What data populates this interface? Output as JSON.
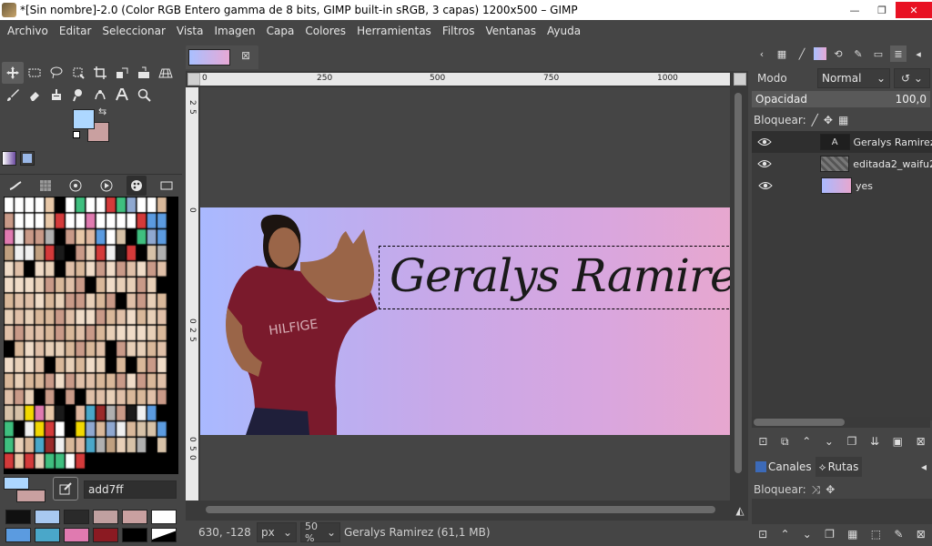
{
  "window": {
    "title": "*[Sin nombre]-2.0 (Color RGB Entero gamma de 8 bits, GIMP built-in sRGB, 3 capas) 1200x500 – GIMP",
    "minimize": "—",
    "maximize": "❐",
    "close": "✕"
  },
  "menu": {
    "items": [
      "Archivo",
      "Editar",
      "Seleccionar",
      "Vista",
      "Imagen",
      "Capa",
      "Colores",
      "Herramientas",
      "Filtros",
      "Ventanas",
      "Ayuda"
    ]
  },
  "toolbox": {
    "tools": [
      "move-tool-icon",
      "rect-select-icon",
      "lasso-icon",
      "fuzzy-select-icon",
      "crop-icon",
      "transform-icon",
      "warp-icon",
      "perspective-icon",
      "paintbrush-icon",
      "eraser-icon",
      "clone-icon",
      "smudge-icon",
      "paths-icon",
      "text-icon",
      "zoom-icon"
    ],
    "foreground_color": "#add7ff",
    "background_color": "#c9a0a0"
  },
  "color_panel": {
    "hex_value": "add7ff",
    "recent_colors": [
      "#101010",
      "#a8c8f0",
      "#2a2a2a",
      "#c0a0a0",
      "#c9a0a0",
      "#ffffff",
      "#5b9be0",
      "#4aa7c9",
      "#e07ab0",
      "#8b1a22",
      "#000000",
      "#ffffff"
    ]
  },
  "image_tab": {
    "close": "⊠"
  },
  "rulers": {
    "h_labels": [
      "0",
      "250",
      "500",
      "750",
      "1000"
    ],
    "v_labels": [
      "2",
      "5",
      "0",
      "0",
      "2",
      "5",
      "0",
      "5",
      "0",
      "0"
    ]
  },
  "canvas": {
    "banner_text": "Geralys Ramirez"
  },
  "status": {
    "coords": "630, -128",
    "unit": "px",
    "zoom": "50 %",
    "info": "Geralys Ramirez (61,1 MB)"
  },
  "layers_panel": {
    "mode_label": "Modo",
    "mode_value": "Normal",
    "opacity_label": "Opacidad",
    "opacity_value": "100,0",
    "lock_label": "Bloquear:",
    "layers": [
      {
        "name": "Geralys Ramirez",
        "active": true
      },
      {
        "name": "editada2_waifu2",
        "active": false
      },
      {
        "name": "yes",
        "active": false
      }
    ],
    "tabs": [
      {
        "label": "Canales"
      },
      {
        "label": "Rutas"
      }
    ],
    "paths_lock_label": "Bloquear:"
  },
  "colors": {
    "ui_bg": "#454545",
    "panel_dark": "#3b3b3b",
    "gradient_start": "#a9b9ff",
    "gradient_end": "#e7a7cf",
    "accent_close": "#e81123"
  }
}
